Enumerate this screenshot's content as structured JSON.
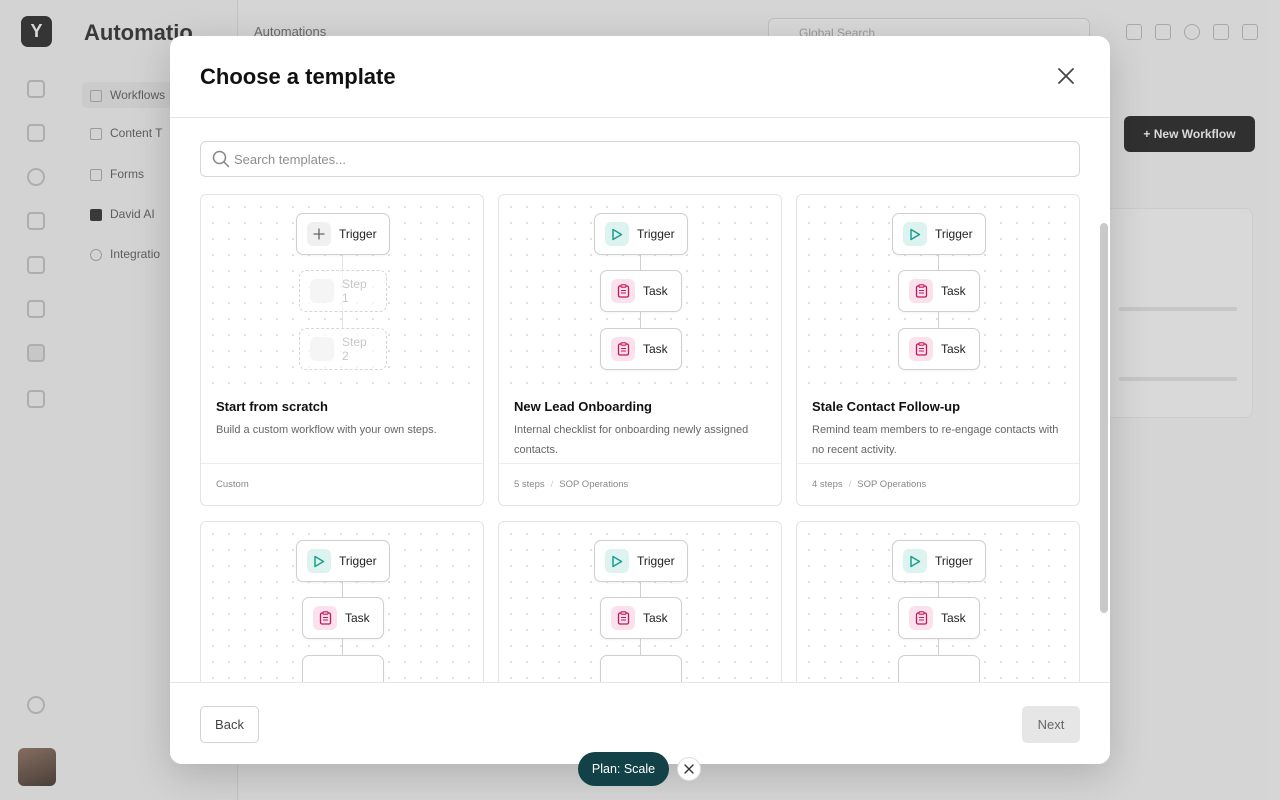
{
  "app": {
    "title": "Automatio",
    "breadcrumb": "Automations",
    "global_search_placeholder": "Global Search",
    "new_workflow_label": "+ New Workflow",
    "nav": [
      "Workflows",
      "Content T",
      "Forms",
      "David AI",
      "Integratio"
    ]
  },
  "modal": {
    "title": "Choose a template",
    "search_placeholder": "Search templates...",
    "back_label": "Back",
    "next_label": "Next"
  },
  "templates": [
    {
      "title": "Start from scratch",
      "description": "Build a custom workflow with your own steps.",
      "meta": [
        "Custom"
      ],
      "nodes": [
        {
          "label": "Trigger",
          "icon": "plus-icon"
        },
        {
          "label": "Step 1",
          "icon": "blank",
          "ghost": true
        },
        {
          "label": "Step 2",
          "icon": "blank",
          "ghost": true
        }
      ]
    },
    {
      "title": "New Lead Onboarding",
      "description": "Internal checklist for onboarding newly assigned contacts.",
      "meta": [
        "5 steps",
        "SOP Operations"
      ],
      "nodes": [
        {
          "label": "Trigger",
          "icon": "play-icon"
        },
        {
          "label": "Task",
          "icon": "clipboard-icon"
        },
        {
          "label": "Task",
          "icon": "clipboard-icon"
        }
      ]
    },
    {
      "title": "Stale Contact Follow-up",
      "description": "Remind team members to re-engage contacts with no recent activity.",
      "meta": [
        "4 steps",
        "SOP Operations"
      ],
      "nodes": [
        {
          "label": "Trigger",
          "icon": "play-icon"
        },
        {
          "label": "Task",
          "icon": "clipboard-icon"
        },
        {
          "label": "Task",
          "icon": "clipboard-icon"
        }
      ]
    },
    {
      "nodes": [
        {
          "label": "Trigger",
          "icon": "play-icon"
        },
        {
          "label": "Task",
          "icon": "clipboard-icon"
        }
      ]
    },
    {
      "nodes": [
        {
          "label": "Trigger",
          "icon": "play-icon"
        },
        {
          "label": "Task",
          "icon": "clipboard-icon"
        }
      ]
    },
    {
      "nodes": [
        {
          "label": "Trigger",
          "icon": "play-icon"
        },
        {
          "label": "Task",
          "icon": "clipboard-icon"
        }
      ]
    }
  ],
  "plan_badge": "Plan: Scale",
  "colors": {
    "trigger_accent": "#1f9e8e",
    "task_accent": "#c2185b",
    "plan_badge_bg": "#124148"
  }
}
